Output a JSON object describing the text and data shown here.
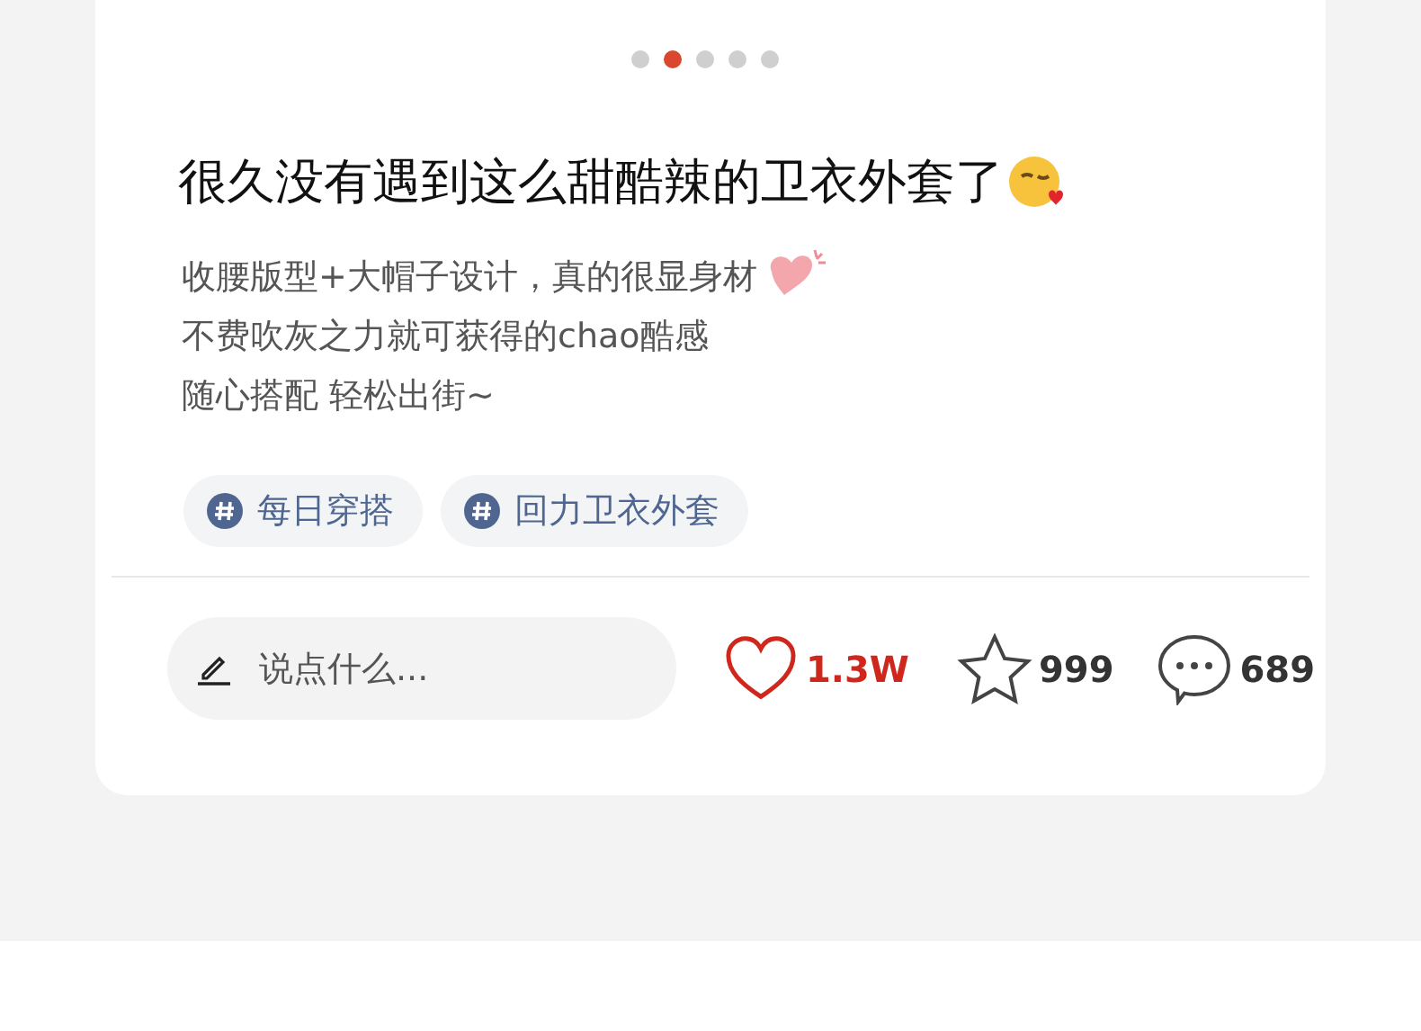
{
  "carousel_dots": [
    {
      "selected": false
    },
    {
      "selected": true
    },
    {
      "selected": false
    },
    {
      "selected": false
    },
    {
      "selected": false
    }
  ],
  "post": {
    "title": "很久没有遇到这么甜酷辣的卫衣外套了",
    "body_lines": [
      "收腰版型+大帽子设计，真的很显身材",
      "不费吹灰之力就可获得的chao酷感",
      "随心搭配 轻松出街~"
    ],
    "tags": [
      {
        "label": "每日穿搭"
      },
      {
        "label": "回力卫衣外套"
      }
    ]
  },
  "actions": {
    "comment_field": {
      "placeholder": "说点什么..."
    },
    "like": {
      "count": "1.3W",
      "liked": true
    },
    "favorite": {
      "count": "999",
      "favorited": false
    },
    "comments": {
      "count": "689"
    }
  }
}
